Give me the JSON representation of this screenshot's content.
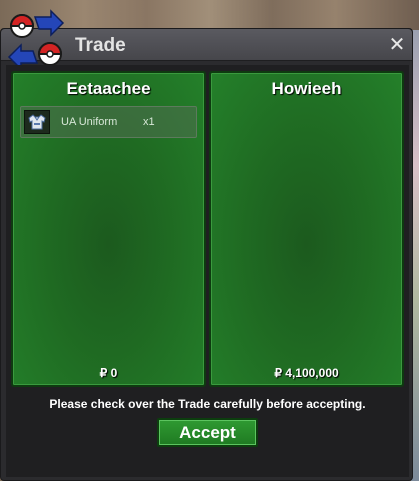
{
  "window": {
    "title": "Trade",
    "close_glyph": "✕",
    "logo_icon": "trade-swap-icon"
  },
  "left_panel": {
    "player": "Eetaachee",
    "items": [
      {
        "icon": "uniform-shirt-icon",
        "name": "UA Uniform",
        "qty": "x1"
      }
    ],
    "money": "₽ 0"
  },
  "right_panel": {
    "player": "Howieeh",
    "items": [],
    "money": "₽ 4,100,000"
  },
  "footer": {
    "notice": "Please check over the Trade carefully before accepting.",
    "accept_label": "Accept"
  },
  "colors": {
    "panel_green": "#1f6a22",
    "button_green": "#2f9a32",
    "window_dark": "#2b2b2e"
  }
}
